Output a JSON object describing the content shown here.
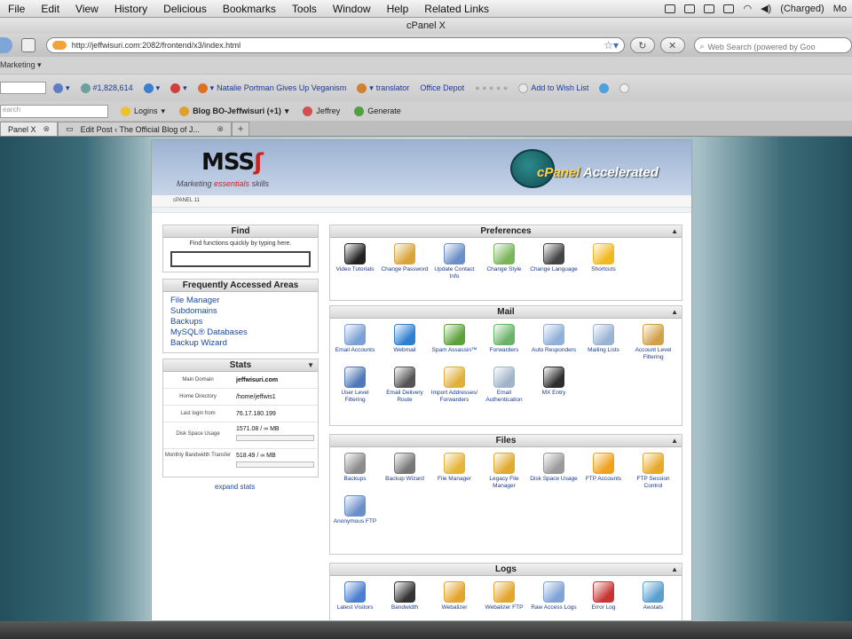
{
  "menubar": {
    "items": [
      "File",
      "Edit",
      "View",
      "History",
      "Delicious",
      "Bookmarks",
      "Tools",
      "Window",
      "Help",
      "Related Links"
    ],
    "battery": "(Charged)",
    "user": "Mo"
  },
  "window": {
    "title": "cPanel X"
  },
  "nav": {
    "url": "http://jeffwisuri.com:2082/frontend/x3/index.html",
    "search_placeholder": "Web Search (powered by Goo"
  },
  "toolbar1": {
    "label": "Marketing"
  },
  "toolbar2": {
    "counter": "#1,828,614",
    "news": "Natalie Portman Gives Up Veganism",
    "translator": "translator",
    "office": "Office Depot",
    "wishlist": "Add to Wish List"
  },
  "toolbar3": {
    "search_placeholder": "earch",
    "logins": "Logins",
    "blog": "Blog BO-Jeffwisuri (+1)",
    "jeffrey": "Jeffrey",
    "generate": "Generate"
  },
  "tabs": [
    {
      "label": "Panel X"
    },
    {
      "label": "Edit Post ‹ The Official Blog of J..."
    }
  ],
  "brand": {
    "logo_text": "MSS",
    "tagline_pre": "Marketing ",
    "tagline_red": "essentials",
    "tagline_post": " skills",
    "cp_main": "cPanel",
    "cp_accel": " Accelerated",
    "breadcrumb": "cPANEL 11"
  },
  "find": {
    "title": "Find",
    "desc": "Find functions quickly by typing here.",
    "value": ""
  },
  "faa": {
    "title": "Frequently Accessed Areas",
    "items": [
      "File Manager",
      "Subdomains",
      "Backups",
      "MySQL® Databases",
      "Backup Wizard"
    ]
  },
  "stats": {
    "title": "Stats",
    "main_domain_label": "Main Domain",
    "main_domain": "jeffwisuri.com",
    "home_dir_label": "Home Directory",
    "home_dir": "/home/jeffwis1",
    "last_login_label": "Last login from",
    "last_login": "76.17.180.199",
    "disk_label": "Disk Space Usage",
    "disk": "1571.08 / ∞ MB",
    "disk_fraction": 0,
    "bw_label": "Monthly Bandwidth Transfer",
    "bw": "518.49 / ∞ MB",
    "bw_fraction": 0,
    "expand": "expand stats"
  },
  "preferences": {
    "title": "Preferences",
    "items": [
      {
        "label": "Video Tutorials",
        "icon": "video-icon",
        "color": "#222222"
      },
      {
        "label": "Change Password",
        "icon": "key-icon",
        "color": "#d9a43a"
      },
      {
        "label": "Update Contact Info",
        "icon": "contact-icon",
        "color": "#6a8fc8"
      },
      {
        "label": "Change Style",
        "icon": "palette-icon",
        "color": "#7bb55a"
      },
      {
        "label": "Change Language",
        "icon": "language-icon",
        "color": "#444444"
      },
      {
        "label": "Shortcuts",
        "icon": "star-icon",
        "color": "#f2b81f"
      }
    ]
  },
  "mail": {
    "title": "Mail",
    "items": [
      {
        "label": "Email Accounts",
        "icon": "envelope-icon",
        "color": "#7aa0d6"
      },
      {
        "label": "Webmail",
        "icon": "globe-icon",
        "color": "#2e7fd0"
      },
      {
        "label": "Spam Assassin™",
        "icon": "spam-icon",
        "color": "#5ba23b"
      },
      {
        "label": "Forwarders",
        "icon": "forward-icon",
        "color": "#6ab36a"
      },
      {
        "label": "Auto Responders",
        "icon": "autoresponder-icon",
        "color": "#8fb0d8"
      },
      {
        "label": "Mailing Lists",
        "icon": "list-icon",
        "color": "#9bb3d3"
      },
      {
        "label": "Account Level Filtering",
        "icon": "filter-icon",
        "color": "#d3a04a"
      },
      {
        "label": "User Level Filtering",
        "icon": "filter-user-icon",
        "color": "#4e78b8"
      },
      {
        "label": "Email Delivery Route",
        "icon": "route-icon",
        "color": "#555555"
      },
      {
        "label": "Import Addresses/ Forwarders",
        "icon": "import-icon",
        "color": "#e0b03a"
      },
      {
        "label": "Email Authentication",
        "icon": "auth-icon",
        "color": "#9fb4c8"
      },
      {
        "label": "MX Entry",
        "icon": "mx-icon",
        "color": "#2d2d2d"
      }
    ]
  },
  "files": {
    "title": "Files",
    "items": [
      {
        "label": "Backups",
        "icon": "backup-icon",
        "color": "#8a8a8a"
      },
      {
        "label": "Backup Wizard",
        "icon": "wizard-icon",
        "color": "#777777"
      },
      {
        "label": "File Manager",
        "icon": "folder-icon",
        "color": "#e5b53a"
      },
      {
        "label": "Legacy File Manager",
        "icon": "folder-legacy-icon",
        "color": "#e0aa2e"
      },
      {
        "label": "Disk Space Usage",
        "icon": "disk-icon",
        "color": "#9a9a9a"
      },
      {
        "label": "FTP Accounts",
        "icon": "ftp-icon",
        "color": "#f0a01a"
      },
      {
        "label": "FTP Session Control",
        "icon": "ftp-session-icon",
        "color": "#e8a828"
      },
      {
        "label": "Anonymous FTP",
        "icon": "anon-ftp-icon",
        "color": "#6a8fc8"
      }
    ]
  },
  "logs": {
    "title": "Logs",
    "items": [
      {
        "label": "Latest Visitors",
        "icon": "visitors-icon",
        "color": "#4a7fcf"
      },
      {
        "label": "Bandwidth",
        "icon": "bandwidth-icon",
        "color": "#333333"
      },
      {
        "label": "Webalizer",
        "icon": "webalizer-icon",
        "color": "#e3a52c"
      },
      {
        "label": "Webalizer FTP",
        "icon": "webalizer-ftp-icon",
        "color": "#e3a52c"
      },
      {
        "label": "Raw Access Logs",
        "icon": "raw-log-icon",
        "color": "#7fa3d6"
      },
      {
        "label": "Error Log",
        "icon": "error-log-icon",
        "color": "#c83434"
      },
      {
        "label": "Awstats",
        "icon": "awstats-icon",
        "color": "#5a9fd0"
      }
    ]
  }
}
